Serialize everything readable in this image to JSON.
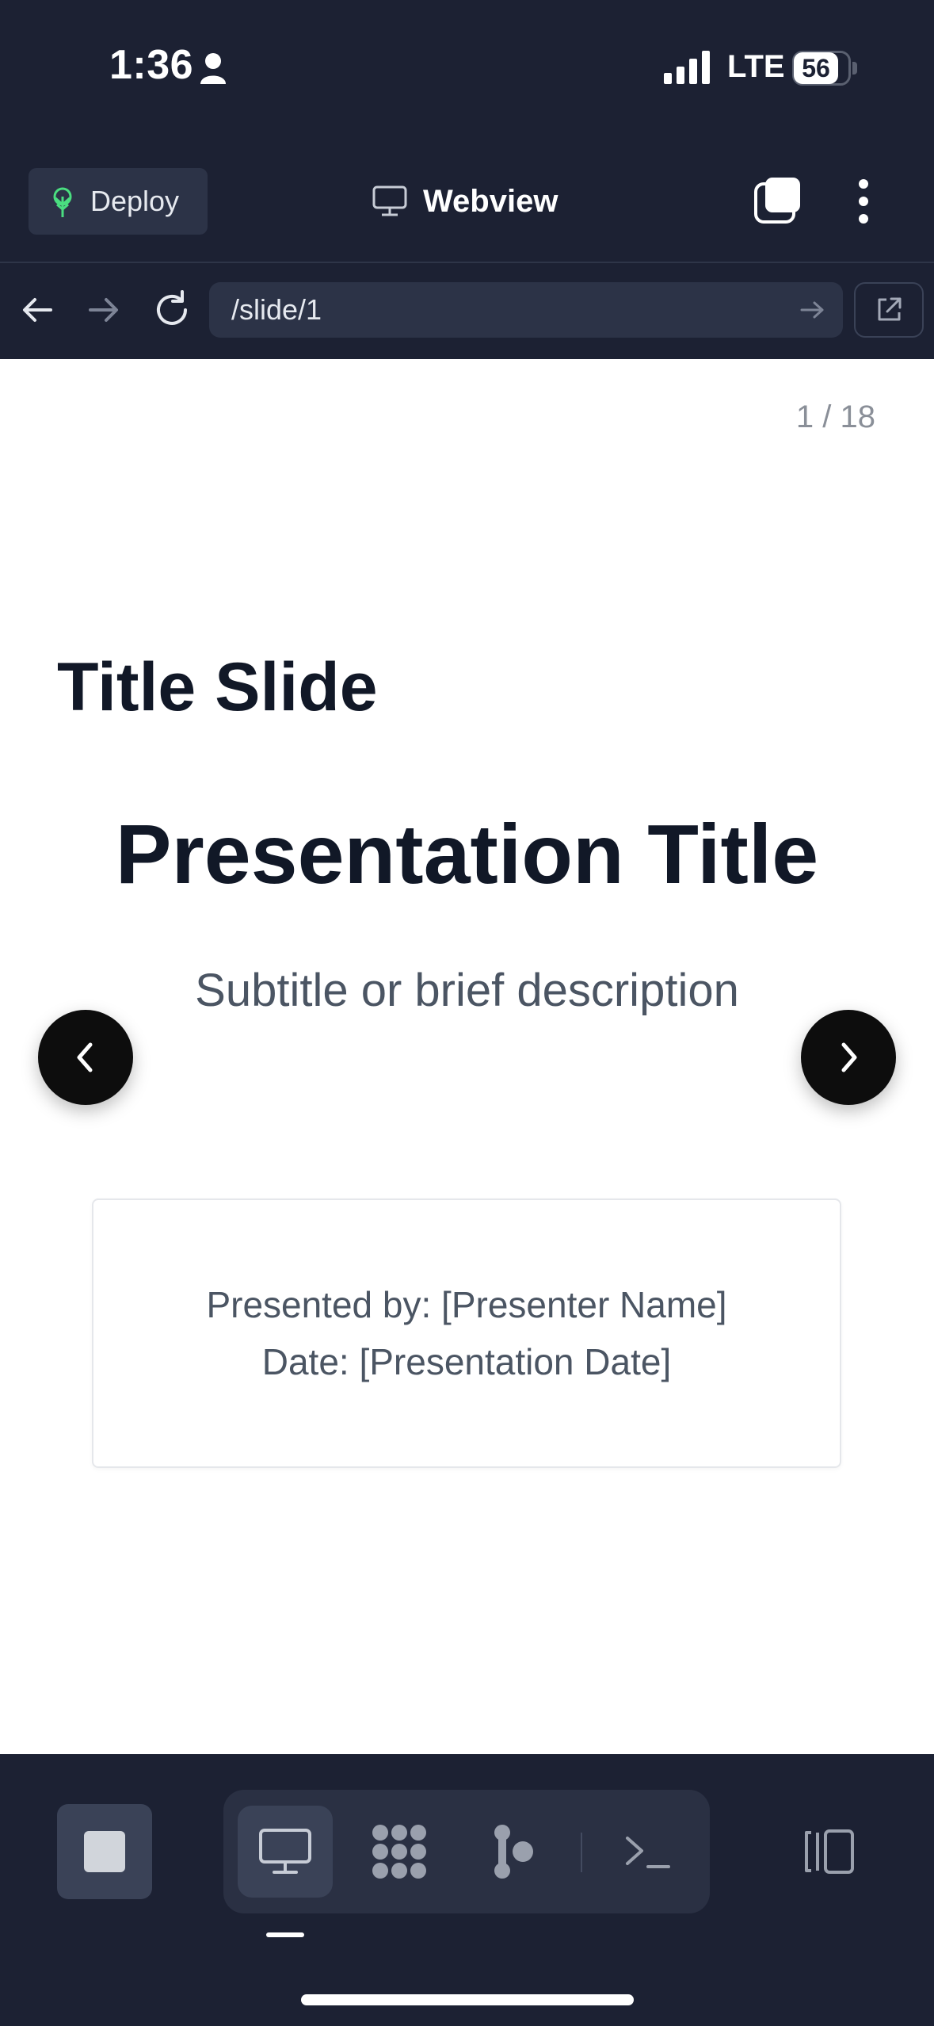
{
  "status_bar": {
    "time": "1:36",
    "network": "LTE",
    "battery": "56"
  },
  "header": {
    "deploy_label": "Deploy",
    "title": "Webview"
  },
  "url_bar": {
    "path": "/slide/1"
  },
  "slide": {
    "counter": "1 / 18",
    "heading": "Title Slide",
    "title": "Presentation Title",
    "subtitle": "Subtitle or brief description",
    "presenter_line": "Presented by: [Presenter Name]",
    "date_line": "Date: [Presentation Date]"
  },
  "colors": {
    "background": "#1c2133",
    "surface": "#2c3347",
    "accent_green": "#4ade80",
    "text_dark": "#111827"
  },
  "icons": {
    "deploy": "sprout-icon",
    "webview": "monitor-icon",
    "tabs": "tabs-icon",
    "more": "kebab-menu-icon",
    "back": "arrow-left-icon",
    "forward": "arrow-right-icon",
    "reload": "reload-icon",
    "external": "external-link-icon",
    "stop": "stop-icon",
    "webview_tool": "monitor-icon",
    "packages": "dots-cluster-icon",
    "git": "git-branch-icon",
    "shell": "terminal-icon",
    "layout": "side-panel-icon"
  }
}
